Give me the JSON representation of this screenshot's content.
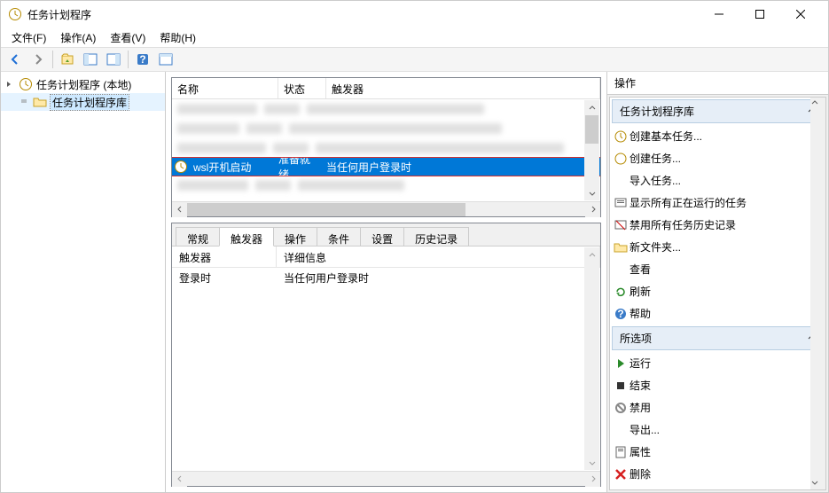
{
  "window": {
    "title": "任务计划程序"
  },
  "menubar": {
    "file": "文件(F)",
    "action": "操作(A)",
    "view": "查看(V)",
    "help": "帮助(H)"
  },
  "tree": {
    "root": "任务计划程序 (本地)",
    "library": "任务计划程序库"
  },
  "task_list": {
    "col_name": "名称",
    "col_state": "状态",
    "col_trigger": "触发器",
    "selected": {
      "name": "wsl开机启动",
      "state": "准备就绪",
      "trigger": "当任何用户登录时"
    }
  },
  "detail_tabs": {
    "general": "常规",
    "triggers": "触发器",
    "actions": "操作",
    "conditions": "条件",
    "settings": "设置",
    "history": "历史记录"
  },
  "trigger_detail": {
    "col_trigger": "触发器",
    "col_info": "详细信息",
    "row_trigger": "登录时",
    "row_info": "当任何用户登录时"
  },
  "actions_pane": {
    "title": "操作",
    "section_library": "任务计划程序库",
    "create_basic": "创建基本任务...",
    "create_task": "创建任务...",
    "import_task": "导入任务...",
    "show_running": "显示所有正在运行的任务",
    "disable_history": "禁用所有任务历史记录",
    "new_folder": "新文件夹...",
    "view": "查看",
    "refresh": "刷新",
    "help": "帮助",
    "section_selected": "所选项",
    "run": "运行",
    "end": "结束",
    "disable": "禁用",
    "export": "导出...",
    "properties": "属性",
    "delete": "删除"
  }
}
